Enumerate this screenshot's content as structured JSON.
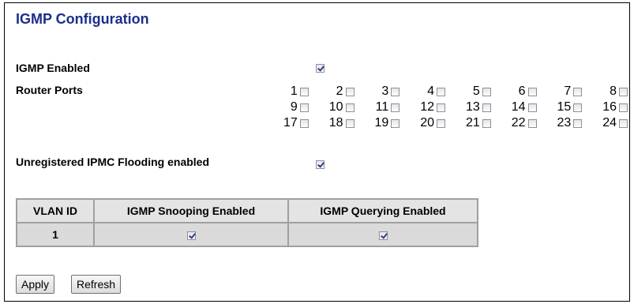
{
  "page_title": "IGMP Configuration",
  "igmp_enabled": {
    "label": "IGMP Enabled",
    "checked": true
  },
  "router_ports": {
    "label": "Router Ports",
    "rows": [
      [
        "1",
        "2",
        "3",
        "4",
        "5",
        "6",
        "7",
        "8"
      ],
      [
        "9",
        "10",
        "11",
        "12",
        "13",
        "14",
        "15",
        "16"
      ],
      [
        "17",
        "18",
        "19",
        "20",
        "21",
        "22",
        "23",
        "24"
      ]
    ]
  },
  "flooding": {
    "label": "Unregistered IPMC Flooding enabled",
    "checked": true
  },
  "vlan_table": {
    "headers": [
      "VLAN ID",
      "IGMP Snooping Enabled",
      "IGMP Querying Enabled"
    ],
    "rows": [
      {
        "vlan_id": "1",
        "snooping": true,
        "querying": true
      }
    ]
  },
  "buttons": {
    "apply": "Apply",
    "refresh": "Refresh"
  }
}
